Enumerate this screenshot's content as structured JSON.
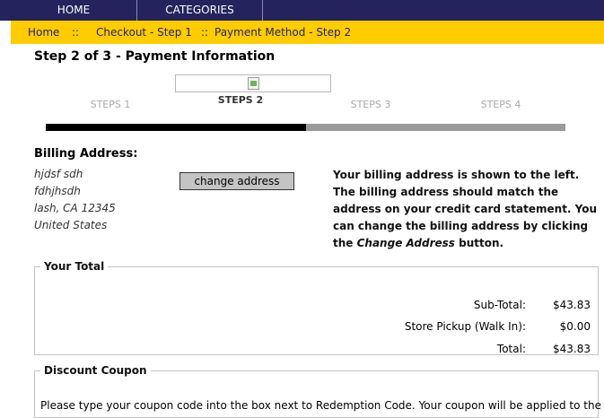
{
  "nav": {
    "items": [
      "HOME",
      "CATEGORIES"
    ]
  },
  "breadcrumb": {
    "home": "Home",
    "separator": "::",
    "step1": "Checkout - Step 1",
    "current": "Payment Method - Step 2"
  },
  "page": {
    "title": "Step 2 of 3 - Payment Information"
  },
  "steps": {
    "labels": [
      "STEPS 1",
      "STEPS 2",
      "STEPS 3",
      "STEPS 4"
    ],
    "active_index": 1,
    "progress_fraction": 0.5
  },
  "billing": {
    "heading": "Billing Address:",
    "address_lines": [
      "hjdsf sdh",
      "fdhjhsdh",
      "lash, CA 12345",
      "United States"
    ],
    "change_button": "change address",
    "note_before": "Your billing address is shown to the left. The billing address should match the address on your credit card statement. You can change the billing address by clicking the ",
    "note_em": "Change Address",
    "note_after": " button."
  },
  "totals": {
    "legend": "Your Total",
    "rows": [
      {
        "label": "Sub-Total:",
        "value": "$43.83"
      },
      {
        "label": "Store Pickup (Walk In):",
        "value": "$0.00"
      },
      {
        "label": "Total:",
        "value": "$43.83"
      }
    ]
  },
  "coupon": {
    "legend": "Discount Coupon",
    "text": "Please type your coupon code into the box next to Redemption Code. Your coupon will be applied to the total"
  },
  "colors": {
    "nav_bg": "#24235e",
    "crumb_bg": "#ffcc00",
    "progress_done": "#000000",
    "progress_remaining": "#9a9a9a"
  }
}
